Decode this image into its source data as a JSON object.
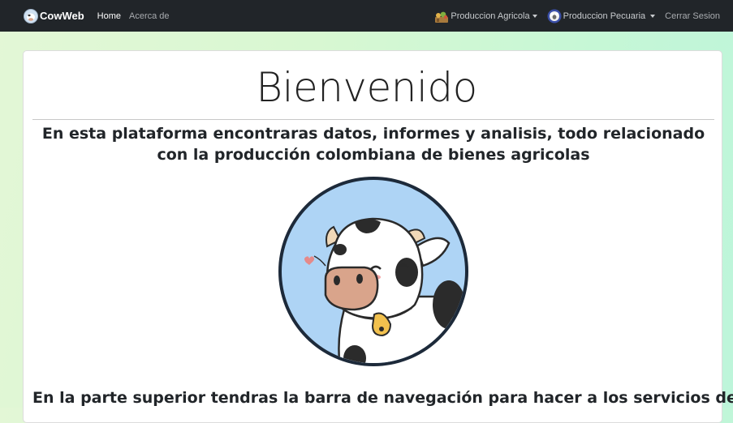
{
  "navbar": {
    "brand": {
      "label": "CowWeb",
      "icon": "cow-logo-icon"
    },
    "links": [
      {
        "label": "Home",
        "active": true
      },
      {
        "label": "Acerca de",
        "active": false
      }
    ],
    "dropdowns": [
      {
        "label": "Produccion Agricola",
        "icon": "crops-icon"
      },
      {
        "label": "Produccion Pecuaria",
        "icon": "sheep-icon"
      }
    ],
    "logout_label": "Cerrar Sesion"
  },
  "main": {
    "title": "Bienvenido",
    "subtitle": "En esta plataforma encontraras datos, informes y analisis, todo relacionado con la producción colombiana de bienes agricolas",
    "image_icon": "cow-illustration",
    "bottom_text": "En la parte superior tendras la barra de navegación para hacer a los servicios de la"
  },
  "colors": {
    "navbar_bg": "#212529",
    "page_bg_left": "#e3f7d6",
    "page_bg_right": "#bdf5da",
    "cow_circle_bg": "#aed4f5",
    "cow_nose": "#d9a48b",
    "bell": "#f2c14e"
  }
}
